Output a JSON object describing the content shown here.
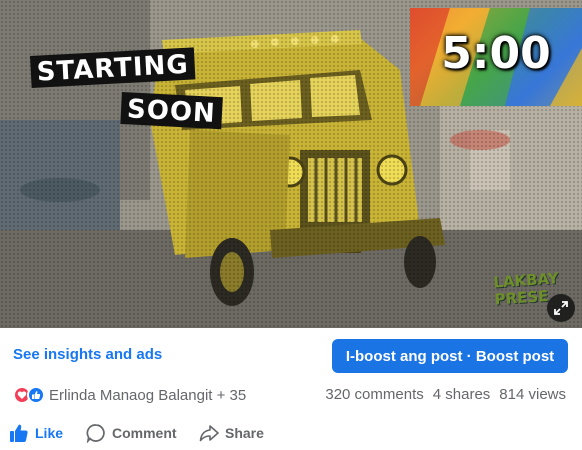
{
  "video": {
    "overlay_line1": "STARTING",
    "overlay_line2": "SOON",
    "timer": "5:00",
    "watermark_line1": "LAKBAY",
    "watermark_line2": "PRESE",
    "expand_icon": "expand-icon"
  },
  "footer": {
    "insights_link": "See insights and ads",
    "boost_button": "I-boost ang post · Boost post",
    "reactions": {
      "icons": [
        "love-icon",
        "like-icon"
      ],
      "colors": {
        "love": "#f33e58",
        "like": "#1877f2"
      },
      "reactors_text": "Erlinda Manaog Balangit + 35"
    },
    "stats": {
      "comments": "320 comments",
      "shares": "4 shares",
      "views": "814 views"
    },
    "actions": {
      "like": "Like",
      "comment": "Comment",
      "share": "Share"
    }
  },
  "colors": {
    "accent": "#1877f2",
    "secondary_text": "#65676b"
  }
}
